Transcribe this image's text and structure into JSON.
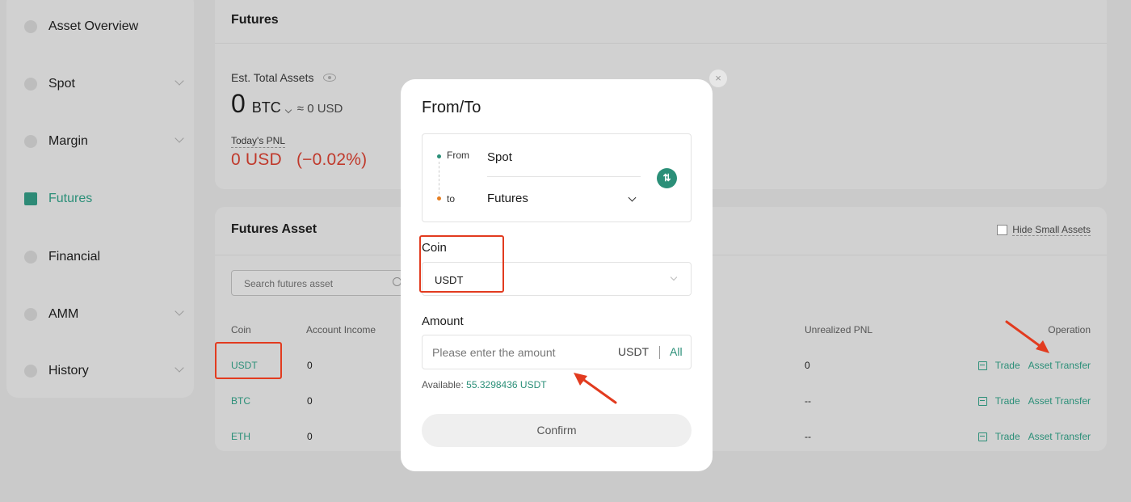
{
  "sidebar": {
    "items": [
      {
        "label": "Asset Overview",
        "icon": "pie-chart-icon",
        "has_chevron": false
      },
      {
        "label": "Spot",
        "icon": "spot-icon",
        "has_chevron": true
      },
      {
        "label": "Margin",
        "icon": "margin-icon",
        "has_chevron": true
      },
      {
        "label": "Futures",
        "icon": "futures-icon",
        "has_chevron": false,
        "active": true
      },
      {
        "label": "Financial",
        "icon": "financial-icon",
        "has_chevron": false
      },
      {
        "label": "AMM",
        "icon": "amm-icon",
        "has_chevron": true
      },
      {
        "label": "History",
        "icon": "history-icon",
        "has_chevron": true
      }
    ]
  },
  "summary": {
    "title": "Futures",
    "est_label": "Est. Total Assets",
    "total_value": "0",
    "total_unit": "BTC",
    "approx": "≈ 0 USD",
    "pnl_label": "Today's PNL",
    "pnl_value": "0 USD   (−0.02%)"
  },
  "asset_table": {
    "title": "Futures Asset",
    "hide_small_label": "Hide Small Assets",
    "search_placeholder": "Search futures asset",
    "headers": {
      "coin": "Coin",
      "account_income": "Account Income",
      "unrealized_pnl": "Unrealized PNL",
      "operation": "Operation"
    },
    "rows": [
      {
        "coin": "USDT",
        "account_income": "0",
        "unrealized_pnl": "0",
        "trade": "Trade",
        "transfer": "Asset Transfer"
      },
      {
        "coin": "BTC",
        "account_income": "0",
        "unrealized_pnl": "--",
        "trade": "Trade",
        "transfer": "Asset Transfer"
      },
      {
        "coin": "ETH",
        "account_income": "0",
        "unrealized_pnl": "--",
        "trade": "Trade",
        "transfer": "Asset Transfer"
      }
    ]
  },
  "modal": {
    "title": "From/To",
    "close_glyph": "×",
    "from_label": "From",
    "from_value": "Spot",
    "to_label": "to",
    "to_value": "Futures",
    "swap_glyph": "⇅",
    "coin_label": "Coin",
    "coin_value": "USDT",
    "amount_label": "Amount",
    "amount_placeholder": "Please enter the amount",
    "amount_unit": "USDT",
    "amount_all": "All",
    "available_label": "Available:",
    "available_value": "55.3298436 USDT",
    "confirm_label": "Confirm"
  },
  "colors": {
    "accent": "#2b8f78",
    "negative": "#c0392b",
    "annotation": "#e23b1f",
    "overlay_bg": "#cacaca"
  }
}
